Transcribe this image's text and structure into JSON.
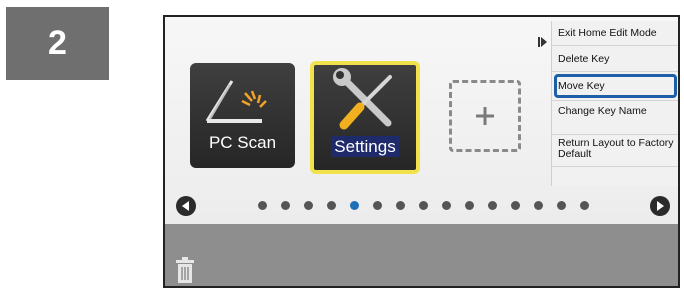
{
  "step": {
    "number": "2"
  },
  "tiles": [
    {
      "label": "PC Scan",
      "icon": "scanner-icon"
    },
    {
      "label": "Settings",
      "icon": "wrench-screwdriver-icon"
    }
  ],
  "add_slot": {
    "icon": "plus-icon"
  },
  "menu": {
    "items": [
      {
        "label": "Exit Home Edit Mode"
      },
      {
        "label": "Delete Key"
      },
      {
        "label": "Move Key"
      },
      {
        "label": "Change Key Name"
      },
      {
        "label": "Return Layout to Factory Default"
      }
    ],
    "selected_index": 2
  },
  "pagination": {
    "page_count": 15,
    "current_page": 5
  },
  "colors": {
    "selection_border": "#f1e14a",
    "menu_highlight": "#1c5fa8",
    "active_dot": "#1e6fb5"
  }
}
